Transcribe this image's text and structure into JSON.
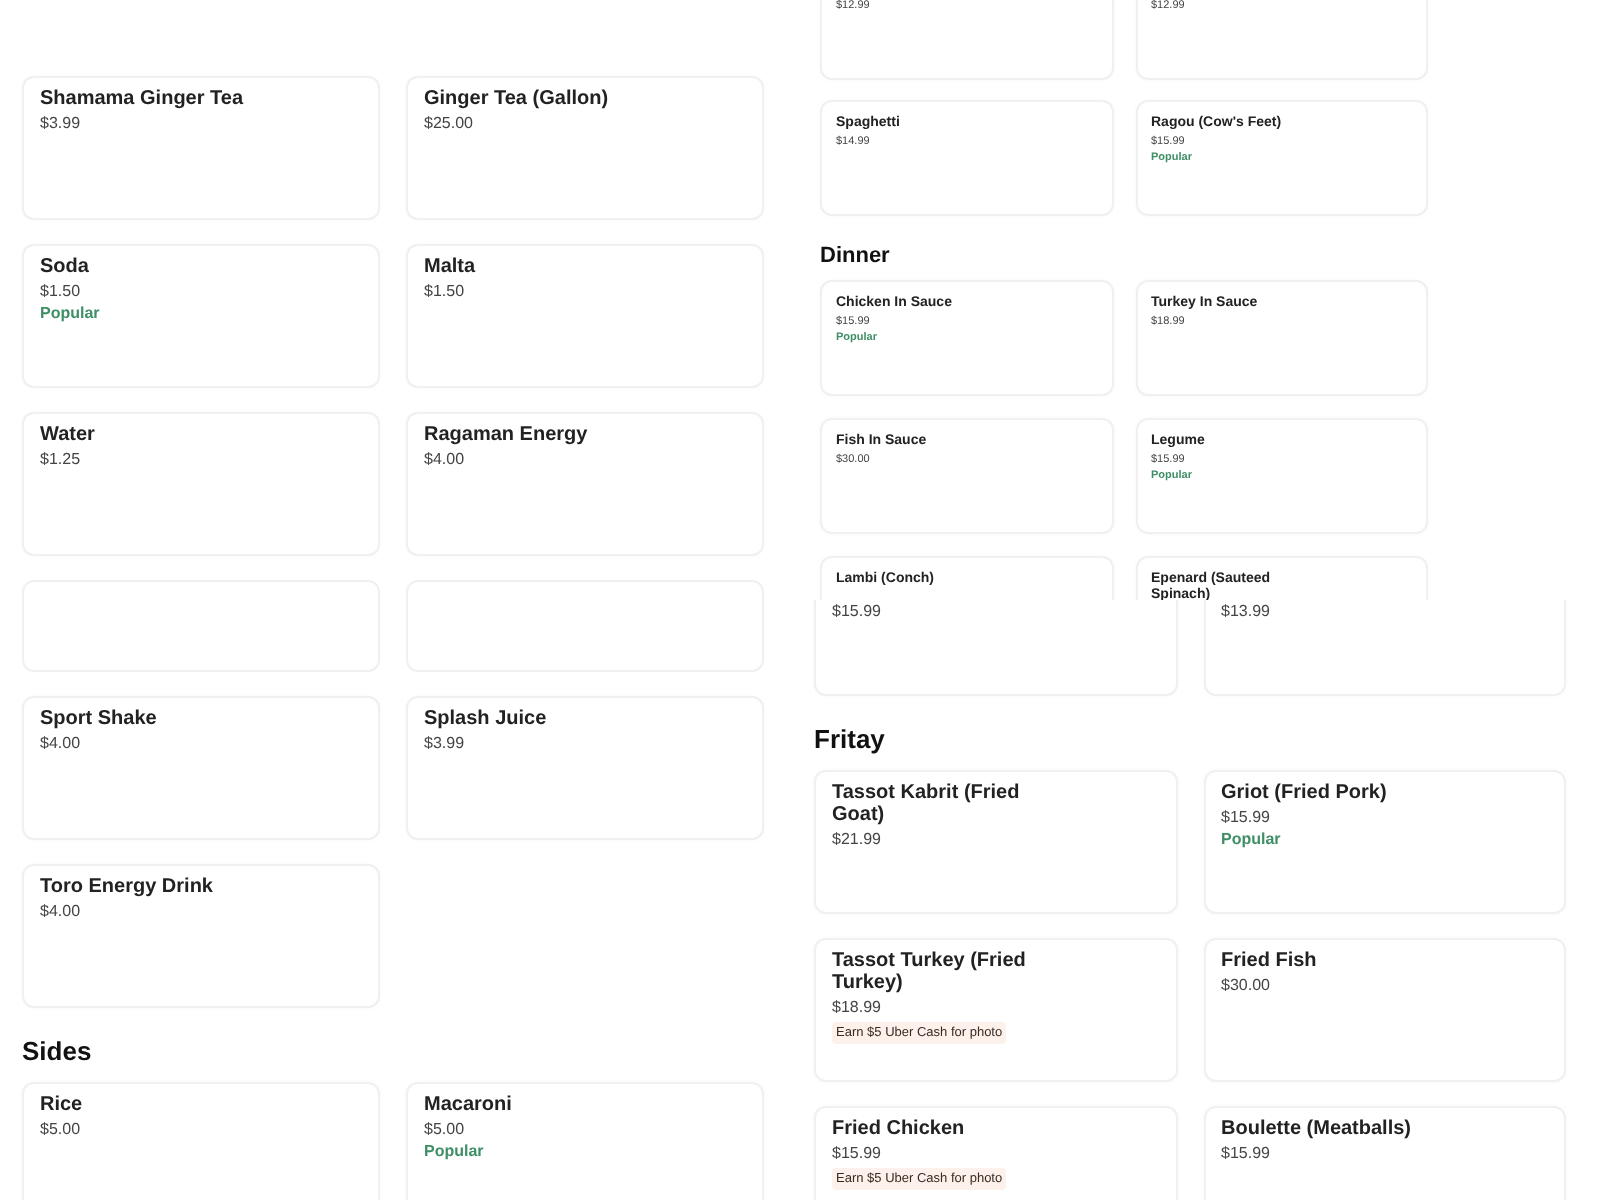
{
  "panels": [
    {
      "kind": "large",
      "blocks": [
        {
          "kind": "cards",
          "items": [
            {
              "name": "Shamama Ginger Tea",
              "price": "$3.99"
            },
            {
              "name": "Ginger Tea (Gallon)",
              "price": "$25.00"
            },
            {
              "name": "Soda",
              "price": "$1.50",
              "tag": "Popular"
            },
            {
              "name": "Malta",
              "price": "$1.50"
            },
            {
              "name": "Water",
              "price": "$1.25"
            },
            {
              "name": "Ragaman Energy",
              "price": "$4.00"
            }
          ]
        },
        {
          "kind": "blank"
        },
        {
          "kind": "cards",
          "items": [
            {
              "name": "Sport Shake",
              "price": "$4.00"
            },
            {
              "name": "Splash Juice",
              "price": "$3.99"
            },
            {
              "name": "Toro Energy Drink",
              "price": "$4.00"
            }
          ]
        },
        {
          "kind": "heading",
          "text": "Sides"
        },
        {
          "kind": "cards",
          "items": [
            {
              "name": "Rice",
              "price": "$5.00"
            },
            {
              "name": "Macaroni",
              "price": "$5.00",
              "tag": "Popular"
            }
          ]
        }
      ]
    },
    {
      "kind": "small",
      "blocks": [
        {
          "kind": "cut",
          "items": [
            {
              "price": "$12.99"
            },
            {
              "price": "$12.99"
            }
          ]
        },
        {
          "kind": "cards",
          "items": [
            {
              "name": "Spaghetti",
              "price": "$14.99"
            },
            {
              "name": "Ragou (Cow's Feet)",
              "price": "$15.99",
              "tag": "Popular"
            }
          ]
        },
        {
          "kind": "heading",
          "text": "Dinner"
        },
        {
          "kind": "cards",
          "items": [
            {
              "name": "Chicken In Sauce",
              "price": "$15.99",
              "tag": "Popular"
            },
            {
              "name": "Turkey In Sauce",
              "price": "$18.99"
            },
            {
              "name": "Fish In Sauce",
              "price": "$30.00"
            },
            {
              "name": "Legume",
              "price": "$15.99",
              "tag": "Popular"
            },
            {
              "name": "Lambi (Conch)"
            },
            {
              "name": "Epenard (Sauteed Spinach)"
            }
          ]
        }
      ]
    },
    {
      "kind": "large",
      "blocks": [
        {
          "kind": "cut",
          "items": [
            {
              "price": "$15.99"
            },
            {
              "price": "$13.99"
            }
          ]
        },
        {
          "kind": "heading",
          "text": "Fritay"
        },
        {
          "kind": "cards",
          "items": [
            {
              "name": "Tassot Kabrit (Fried Goat)",
              "price": "$21.99"
            },
            {
              "name": "Griot (Fried Pork)",
              "price": "$15.99",
              "tag": "Popular"
            },
            {
              "name": "Tassot Turkey (Fried Turkey)",
              "price": "$18.99",
              "promo": "Earn $5 Uber Cash for photo"
            },
            {
              "name": "Fried Fish",
              "price": "$30.00"
            },
            {
              "name": "Fried Chicken",
              "price": "$15.99",
              "promo": "Earn $5 Uber Cash for photo"
            },
            {
              "name": "Boulette (Meatballs)",
              "price": "$15.99"
            }
          ]
        }
      ]
    }
  ]
}
